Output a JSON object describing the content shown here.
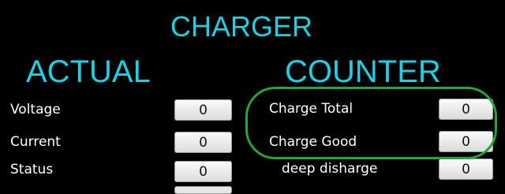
{
  "header": {
    "title": "CHARGER",
    "actual_heading": "ACTUAL",
    "counter_heading": "COUNTER"
  },
  "actual": {
    "rows": [
      {
        "label": "Voltage",
        "value": "0"
      },
      {
        "label": "Current",
        "value": "0"
      },
      {
        "label": "Status",
        "value": "0"
      }
    ]
  },
  "counter": {
    "rows": [
      {
        "label": "Charge Total",
        "value": "0"
      },
      {
        "label": "Charge Good",
        "value": "0"
      },
      {
        "label": "deep disharge",
        "value": "0"
      }
    ]
  },
  "colors": {
    "background": "#000000",
    "heading": "#1FD0E3",
    "label": "#FFFFFF",
    "highlight_ring": "#22A53A",
    "value_box": "#EDEDED"
  }
}
